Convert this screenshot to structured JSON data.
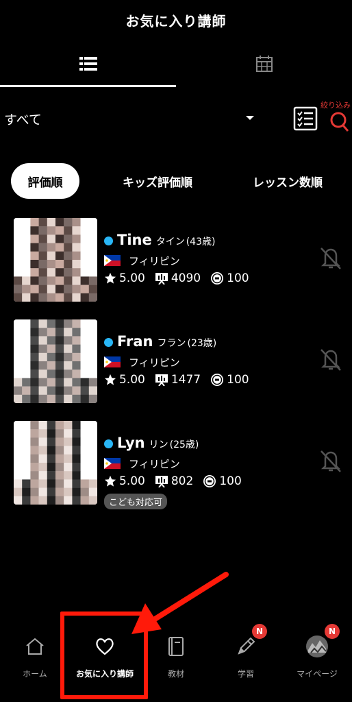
{
  "header": {
    "title": "お気に入り講師"
  },
  "view_tabs": [
    {
      "name": "list",
      "icon": "list-icon",
      "active": true
    },
    {
      "name": "calendar",
      "icon": "calendar-icon",
      "active": false
    }
  ],
  "filter": {
    "selected": "すべて",
    "search_label": "絞り込み"
  },
  "sort_tabs": [
    {
      "label": "評価順",
      "active": true
    },
    {
      "label": "キッズ評価順",
      "active": false
    },
    {
      "label": "レッスン数順",
      "active": false
    }
  ],
  "teachers": [
    {
      "name": "Tine",
      "kana": "タイン",
      "age": "(43歳)",
      "country": "フィリピン",
      "rating": "5.00",
      "lessons": "4090",
      "coins": "100",
      "kids_badge": ""
    },
    {
      "name": "Fran",
      "kana": "フラン",
      "age": "(23歳)",
      "country": "フィリピン",
      "rating": "5.00",
      "lessons": "1477",
      "coins": "100",
      "kids_badge": ""
    },
    {
      "name": "Lyn",
      "kana": "リン",
      "age": "(25歳)",
      "country": "フィリピン",
      "rating": "5.00",
      "lessons": "802",
      "coins": "100",
      "kids_badge": "こども対応可"
    }
  ],
  "bottom_nav": [
    {
      "label": "ホーム",
      "icon": "home-icon",
      "active": false,
      "badge": ""
    },
    {
      "label": "お気に入り講師",
      "icon": "heart-icon",
      "active": true,
      "badge": ""
    },
    {
      "label": "教材",
      "icon": "book-icon",
      "active": false,
      "badge": ""
    },
    {
      "label": "学習",
      "icon": "pencil-icon",
      "active": false,
      "badge": "N"
    },
    {
      "label": "マイページ",
      "icon": "profile-avatar-icon",
      "active": false,
      "badge": "N"
    }
  ],
  "colors": {
    "background": "#000000",
    "online": "#29b6f6",
    "accent_red": "#e53935",
    "annotation_red": "#ff1a0a"
  }
}
